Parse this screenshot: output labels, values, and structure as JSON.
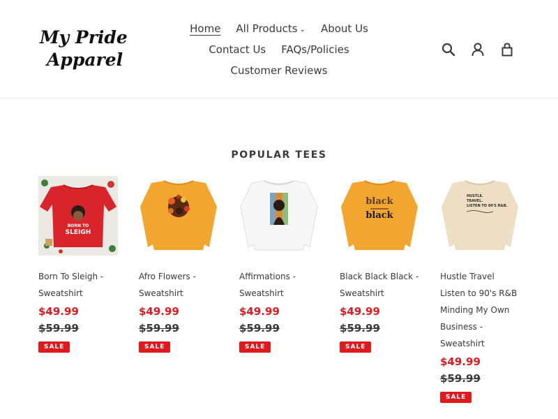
{
  "brand": {
    "logo_line1": "My Pride",
    "logo_line2": "Apparel"
  },
  "nav": {
    "row1": [
      {
        "label": "Home",
        "active": true
      },
      {
        "label": "All Products",
        "dropdown": true
      },
      {
        "label": "About Us"
      }
    ],
    "row2": [
      {
        "label": "Contact Us"
      },
      {
        "label": "FAQs/Policies"
      }
    ],
    "row3": [
      {
        "label": "Customer Reviews"
      }
    ]
  },
  "header_icons": [
    "search-icon",
    "account-icon",
    "cart-icon"
  ],
  "section": {
    "title": "POPULAR TEES"
  },
  "products": [
    {
      "name": "Born To Sleigh - Sweatshirt",
      "sale_price": "$49.99",
      "original_price": "$59.99",
      "badge": "SALE",
      "shirt_color": "#d8242a"
    },
    {
      "name": "Afro Flowers - Sweatshirt",
      "sale_price": "$49.99",
      "original_price": "$59.99",
      "badge": "SALE",
      "shirt_color": "#f2a630"
    },
    {
      "name": "Affirmations - Sweatshirt",
      "sale_price": "$49.99",
      "original_price": "$59.99",
      "badge": "SALE",
      "shirt_color": "#f7f7f7"
    },
    {
      "name": "Black Black Black - Sweatshirt",
      "sale_price": "$49.99",
      "original_price": "$59.99",
      "badge": "SALE",
      "shirt_color": "#f2a630"
    },
    {
      "name": "Hustle Travel Listen to 90's R&B Minding My Own Business - Sweatshirt",
      "sale_price": "$49.99",
      "original_price": "$59.99",
      "badge": "SALE",
      "shirt_color": "#eedfc4"
    }
  ],
  "print_text": {
    "p0": [
      "BORN TO",
      "SLEIGH"
    ],
    "p3": [
      "black",
      "black"
    ],
    "p4": [
      "HUSTLE.",
      "TRAVEL.",
      "LISTEN TO 90'S R&B."
    ]
  },
  "colors": {
    "sale": "#e0191d",
    "text": "#3a3a3a",
    "border": "#e8e8e8"
  }
}
